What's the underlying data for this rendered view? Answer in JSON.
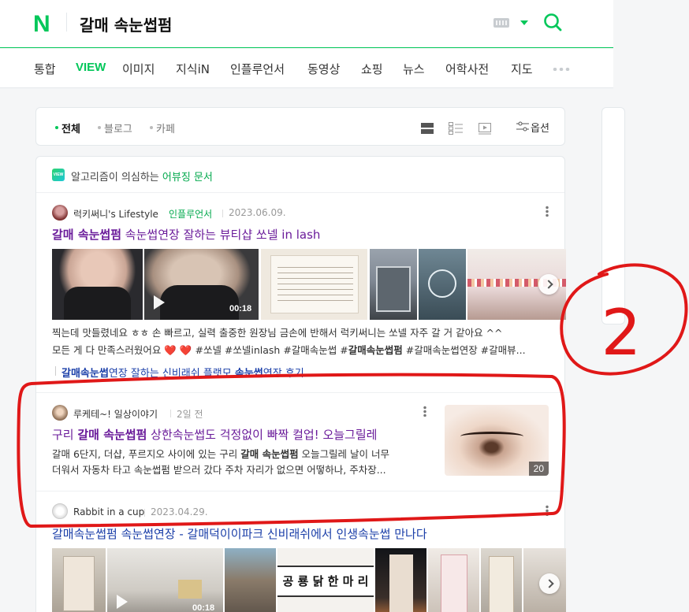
{
  "header": {
    "logo": "N",
    "query": "갈매 속눈썹펌"
  },
  "tabs": [
    "통합",
    "VIEW",
    "이미지",
    "지식iN",
    "인플루언서",
    "동영상",
    "쇼핑",
    "뉴스",
    "어학사전",
    "지도"
  ],
  "active_tab": "VIEW",
  "filter": {
    "items": [
      "전체",
      "블로그",
      "카페"
    ],
    "selected": "전체",
    "option_label": "옵션"
  },
  "notice": {
    "badge": "VIEW",
    "prefix": "알고리즘이 의심하는 ",
    "link": "어뷰징 문서"
  },
  "results": [
    {
      "author": "럭키써니's Lifestyle",
      "badge": "인플루언서",
      "date": "2023.06.09.",
      "title_bold": "갈매 속눈썹펌",
      "title_rest": " 속눈썹연장 잘하는 뷰티샵 쏘넬 in lash",
      "video_duration": "00:18",
      "desc_line1": "찍는데 맛들렸네요 ㅎㅎ 손 빠르고, 실력 출중한 원장님 금손에 반해서 럭키써니는 쏘넬 자주 갈 거 같아요 ^^",
      "desc_line2_a": "모든 게 다 만족스러웠어요 ❤️ ❤️ #쏘넬 #쏘넬inlash #갈매속눈썹 #",
      "desc_line2_bold": "갈매속눈썹펌",
      "desc_line2_b": " #갈매속눈썹연장 #갈매뷰...",
      "sublink_bold1": "갈매속눈썹",
      "sublink_mid": "연장 잘하는 신비래쉬 플랫모 ",
      "sublink_bold2": "속눈썹",
      "sublink_end": "연장 후기"
    },
    {
      "author": "루케테~! 일상이야기",
      "date": "2일 전",
      "title_pre": "구리 ",
      "title_bold": "갈매 속눈썹펌",
      "title_rest": " 상한속눈썹도 걱정없이 빠짝 컬업! 오늘그릴레",
      "desc_line1_a": "갈매 6단지, 더샵, 푸르지오 사이에 있는 구리 ",
      "desc_line1_bold": "갈매 속눈썹펌",
      "desc_line1_b": " 오늘그릴레 날이 너무",
      "desc_line2": "더워서 자동차 타고 속눈썹펌 받으러 갔다 주차 자리가 없으면 어떻하나, 주차장...",
      "image_count": "20"
    },
    {
      "author": "Rabbit in a cup",
      "date": "2023.04.29.",
      "title": "갈매속눈썹펌 속눈썹연장 - 갈매덕이이파크 신비래쉬에서 인생속눈썹 만나다",
      "video_duration": "00:18",
      "sign_text": "공 룡 닭 한 마 리"
    }
  ],
  "annotation": {
    "label": "2",
    "color": "#e01818"
  },
  "colors": {
    "brand": "#03c75a",
    "visited_title": "#6a1b9a",
    "link": "#1a3ea8"
  }
}
